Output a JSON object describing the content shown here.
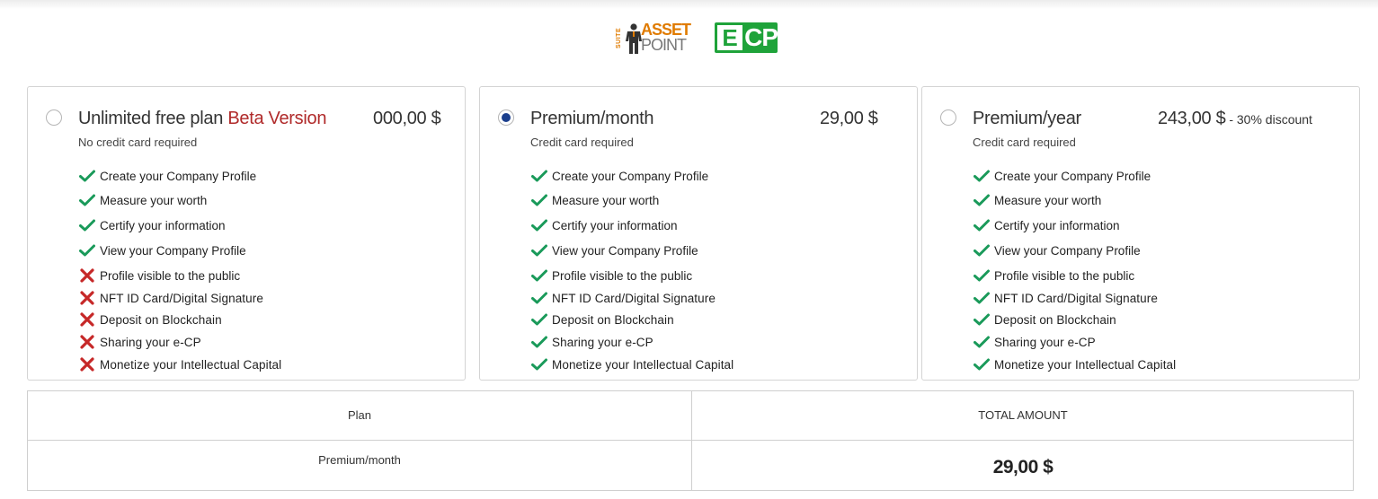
{
  "logos": {
    "suite": "SUITE",
    "asset": "ASSET",
    "point": "POINT",
    "ecp_e": "E",
    "ecp_cp": "CP"
  },
  "colors": {
    "check": "#1a9a5a",
    "cross": "#c62828",
    "selected_radio": "#1a3e8c",
    "beta": "#b02a2a",
    "ecp_green": "#1fa33a",
    "assetpoint_orange": "#e07b00"
  },
  "plans": [
    {
      "title": "Unlimited free plan",
      "title_suffix": "Beta Version",
      "price": "000,00 $",
      "subtitle": "No credit card required",
      "selected": false,
      "features": [
        {
          "label": "Create your Company Profile",
          "included": true
        },
        {
          "label": "Measure your worth",
          "included": true
        },
        {
          "label": "Certify your information",
          "included": true
        },
        {
          "label": "View your Company Profile",
          "included": true
        },
        {
          "label": "Profile visible to the public",
          "included": false
        },
        {
          "label": "NFT ID Card/Digital Signature",
          "included": false
        },
        {
          "label": "Deposit on Blockchain",
          "included": false
        },
        {
          "label": "Sharing your  e-CP",
          "included": false
        },
        {
          "label": "Monetize your Intellectual Capital",
          "included": false
        }
      ]
    },
    {
      "title": "Premium/month",
      "title_suffix": "",
      "price": "29,00 $",
      "subtitle": "Credit card required",
      "selected": true,
      "features": [
        {
          "label": "Create your Company Profile",
          "included": true
        },
        {
          "label": "Measure your worth",
          "included": true
        },
        {
          "label": "Certify your information",
          "included": true
        },
        {
          "label": "View your Company Profile",
          "included": true
        },
        {
          "label": "Profile visible to the public",
          "included": true
        },
        {
          "label": "NFT ID Card/Digital Signature",
          "included": true
        },
        {
          "label": "Deposit on Blockchain",
          "included": true
        },
        {
          "label": "Sharing your  e-CP",
          "included": true
        },
        {
          "label": "Monetize your Intellectual Capital",
          "included": true
        }
      ]
    },
    {
      "title": "Premium/year",
      "title_suffix": "",
      "price": "243,00 $",
      "discount": " - 30% discount",
      "subtitle": "Credit card required",
      "selected": false,
      "features": [
        {
          "label": "Create your Company Profile",
          "included": true
        },
        {
          "label": "Measure your worth",
          "included": true
        },
        {
          "label": "Certify your information",
          "included": true
        },
        {
          "label": "View your Company Profile",
          "included": true
        },
        {
          "label": "Profile visible to the public",
          "included": true
        },
        {
          "label": "NFT ID Card/Digital Signature",
          "included": true
        },
        {
          "label": "Deposit on Blockchain",
          "included": true
        },
        {
          "label": "Sharing your  e-CP",
          "included": true
        },
        {
          "label": "Monetize your Intellectual Capital",
          "included": true
        }
      ]
    }
  ],
  "summary": {
    "plan_header": "Plan",
    "total_header": "TOTAL AMOUNT",
    "plan_value": "Premium/month",
    "total_value": "29,00 $"
  }
}
